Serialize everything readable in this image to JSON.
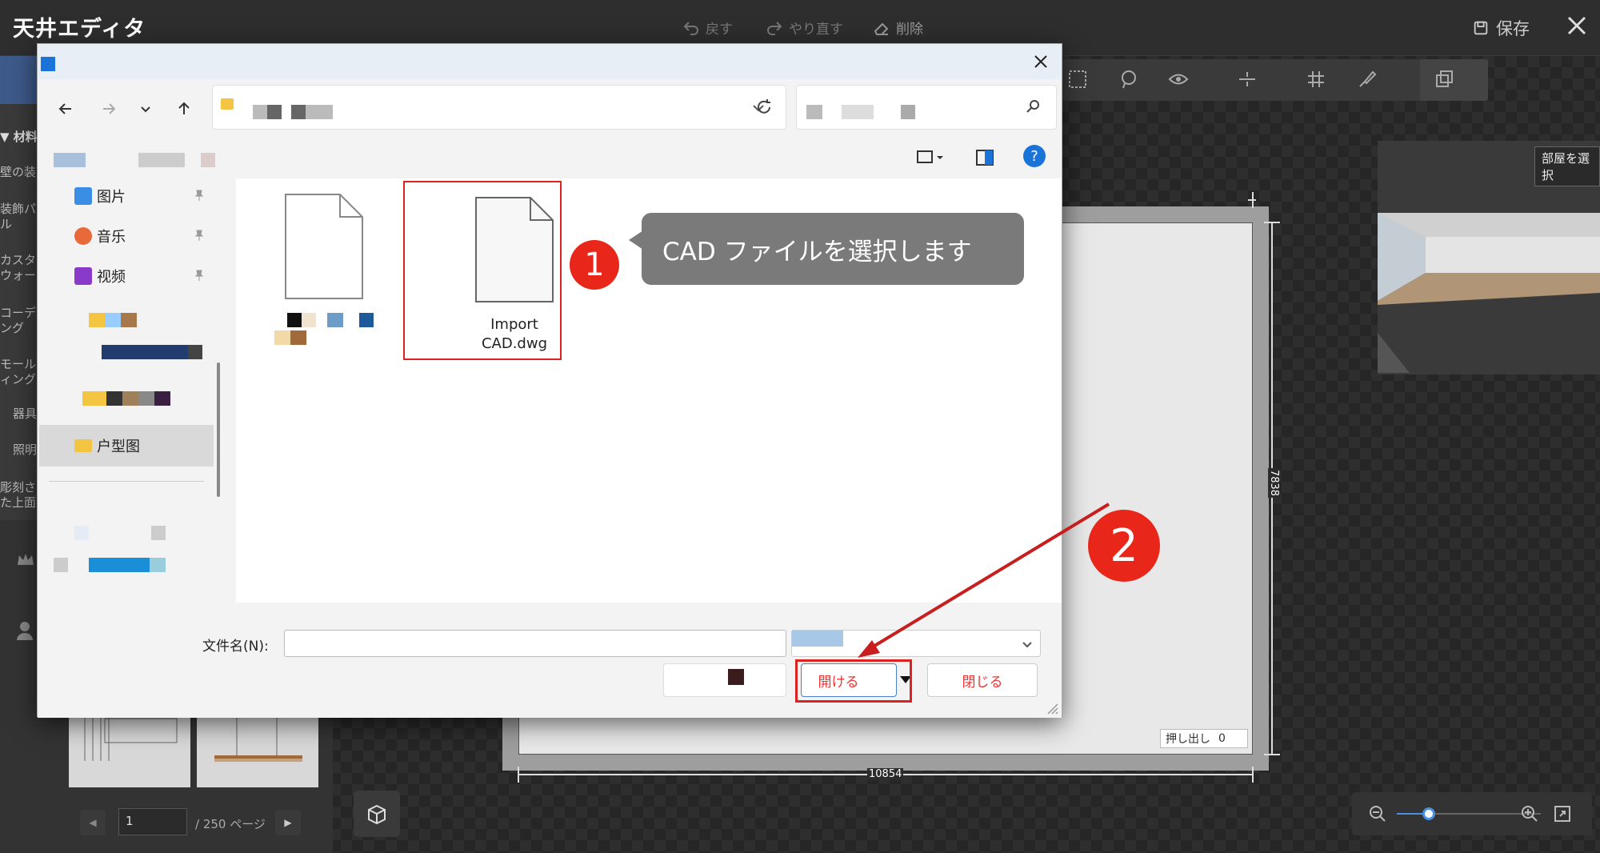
{
  "app": {
    "title": "天井エディタ",
    "undo_label": "戻す",
    "redo_label": "やり直す",
    "delete_label": "削除",
    "save_label": "保存"
  },
  "left_panel": {
    "section": "▼ 材料",
    "items": [
      "壁の装",
      "装飾パ\nル",
      "カスタ\nウォー",
      "コーデ\nング",
      "モール\nィング",
      "器具",
      "照明",
      "彫刻さ\nた上面"
    ]
  },
  "canvas": {
    "dim_width": "10854",
    "dim_height": "7838",
    "extrude_label": "押し出し",
    "extrude_value": "0",
    "preview_button": "部屋を選択"
  },
  "pager": {
    "page_value": "1",
    "page_total": "/ 250 ページ"
  },
  "dialog": {
    "sidebar": {
      "pictures": "图片",
      "music": "音乐",
      "video": "视频",
      "floorplan": "户型图"
    },
    "files": [
      {
        "name": "Import\nCAD.dwg"
      }
    ],
    "filename_label": "文件名(N):",
    "filename_value": "",
    "open_label": "開ける",
    "close_label": "閉じる"
  },
  "annotations": {
    "step1": "1",
    "step2": "2",
    "callout": "CAD ファイルを選択します"
  },
  "colors": {
    "annotation_red": "#e8261a",
    "app_bg": "#2b2b2b",
    "accent_blue": "#4a90e2"
  }
}
